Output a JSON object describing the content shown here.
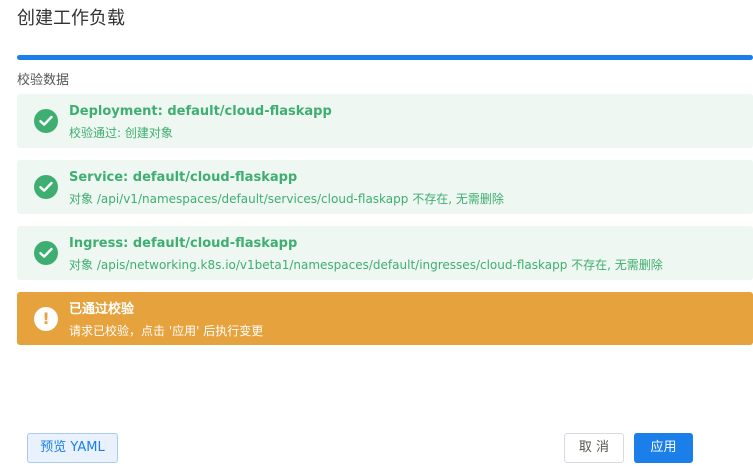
{
  "page": {
    "title": "创建工作负载"
  },
  "progress": {
    "percent": 100,
    "color": "#1a7fe8"
  },
  "section": {
    "label": "校验数据"
  },
  "checks": [
    {
      "status": "success",
      "title": "Deployment: default/cloud-flaskapp",
      "message": "校验通过: 创建对象",
      "icon": "check-circle-icon"
    },
    {
      "status": "success",
      "title": "Service: default/cloud-flaskapp",
      "message": "对象 /api/v1/namespaces/default/services/cloud-flaskapp 不存在, 无需删除",
      "icon": "check-circle-icon"
    },
    {
      "status": "success",
      "title": "Ingress: default/cloud-flaskapp",
      "message": "对象 /apis/networking.k8s.io/v1beta1/namespaces/default/ingresses/cloud-flaskapp 不存在, 无需删除",
      "icon": "check-circle-icon"
    }
  ],
  "notice": {
    "status": "warning",
    "title": "已通过校验",
    "message": "请求已校验，点击 '应用' 后执行变更",
    "icon": "exclamation-circle-icon"
  },
  "footer": {
    "preview_label": "预览 YAML",
    "cancel_label": "取 消",
    "apply_label": "应用"
  },
  "colors": {
    "success": "#3fae71",
    "success_bg": "#eef7f1",
    "warning": "#e6a23c",
    "primary": "#1a7fe8"
  }
}
